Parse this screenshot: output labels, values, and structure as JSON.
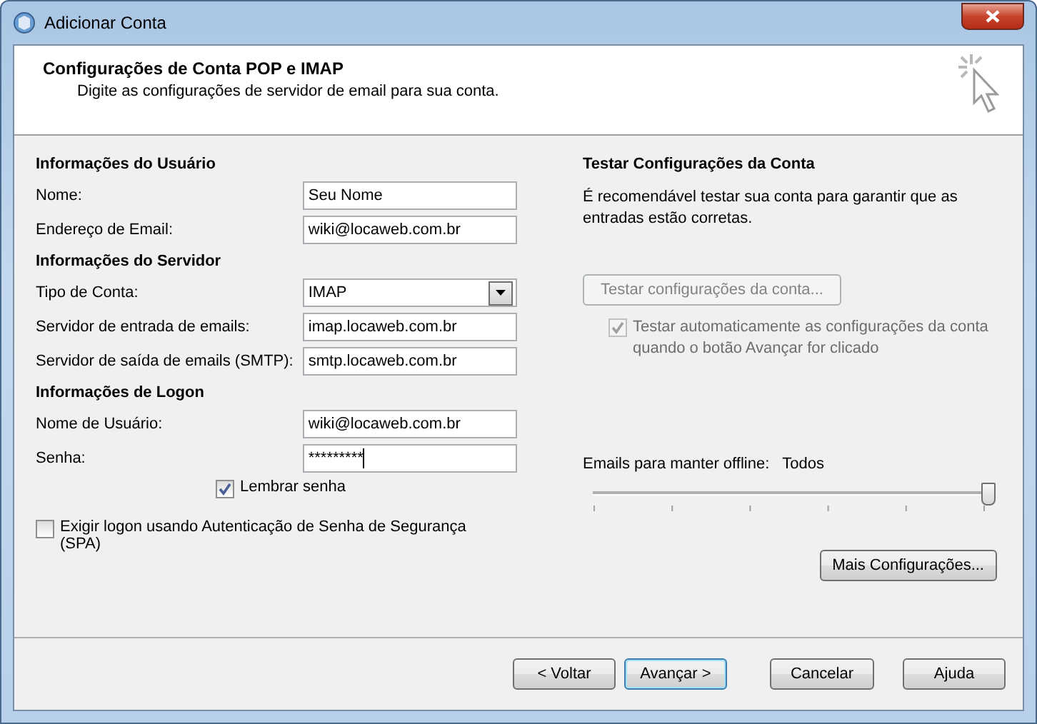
{
  "window": {
    "title": "Adicionar Conta"
  },
  "header": {
    "title": "Configurações de Conta POP e IMAP",
    "subtitle": "Digite as configurações de servidor de email para sua conta."
  },
  "sections": [
    {
      "title": "Informações do Usuário",
      "fields": [
        {
          "kind": "text",
          "label": "Nome:",
          "value": "Seu Nome"
        },
        {
          "kind": "text",
          "label": "Endereço de Email:",
          "value": "wiki@locaweb.com.br"
        }
      ]
    },
    {
      "title": "Informações do Servidor",
      "fields": [
        {
          "kind": "select",
          "label": "Tipo de Conta:",
          "value": "IMAP"
        },
        {
          "kind": "text",
          "label": "Servidor de entrada de emails:",
          "value": "imap.locaweb.com.br"
        },
        {
          "kind": "text",
          "label": "Servidor de saída de emails (SMTP):",
          "value": "smtp.locaweb.com.br"
        }
      ]
    },
    {
      "title": "Informações de Logon",
      "fields": [
        {
          "kind": "text",
          "label": "Nome de Usuário:",
          "value": "wiki@locaweb.com.br"
        },
        {
          "kind": "password",
          "label": "Senha:",
          "value": "*********"
        }
      ]
    }
  ],
  "remember_password": {
    "label": "Lembrar senha",
    "checked": true
  },
  "spa": {
    "label": "Exigir logon usando Autenticação de Senha de Segurança (SPA)",
    "checked": false
  },
  "test": {
    "title": "Testar Configurações da Conta",
    "description": "É recomendável testar sua conta para garantir que as entradas estão corretas.",
    "button": {
      "label": "Testar configurações da conta...",
      "disabled": true
    },
    "auto_test": {
      "label": "Testar automaticamente as configurações da conta quando o botão Avançar for clicado",
      "checked": true,
      "disabled": true
    }
  },
  "offline": {
    "label": "Emails para manter offline:",
    "value": "Todos",
    "level": 1
  },
  "more_button": "Mais Configurações...",
  "buttons": [
    {
      "label": "< Voltar",
      "default": false
    },
    {
      "label": "Avançar >",
      "default": true
    },
    {
      "label": "Cancelar",
      "default": false
    },
    {
      "label": "Ajuda",
      "default": false
    }
  ]
}
